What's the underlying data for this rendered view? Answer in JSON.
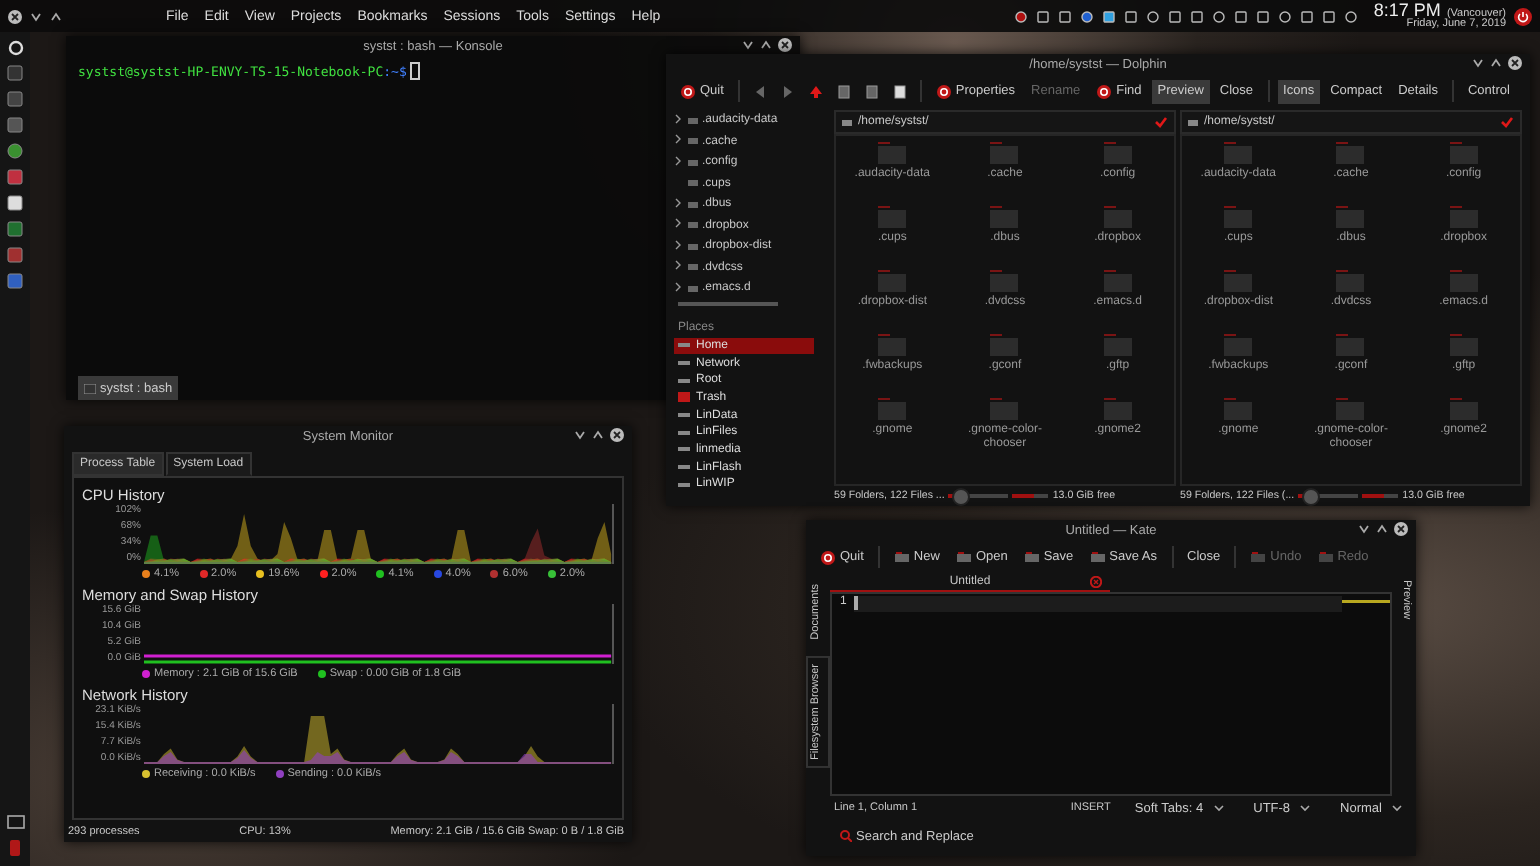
{
  "top_panel": {
    "menu": [
      "File",
      "Edit",
      "View",
      "Projects",
      "Bookmarks",
      "Sessions",
      "Tools",
      "Settings",
      "Help"
    ],
    "clock": {
      "time": "8:17 PM",
      "zone": "(Vancouver)",
      "date": "Friday, June 7, 2019"
    }
  },
  "konsole": {
    "title": "systst : bash — Konsole",
    "prompt": "systst@systst-HP-ENVY-TS-15-Notebook-PC",
    "prompt_suffix": ":~$",
    "tab": "systst : bash"
  },
  "dolphin": {
    "title": "/home/systst — Dolphin",
    "toolbar": [
      {
        "label": "Quit",
        "kind": "icon",
        "selected": false,
        "disabled": false
      },
      {
        "kind": "nav"
      },
      {
        "label": "Properties",
        "kind": "icon",
        "selected": false,
        "disabled": false
      },
      {
        "label": "Rename",
        "kind": "text",
        "selected": false,
        "disabled": true
      },
      {
        "label": "Find",
        "kind": "icon",
        "selected": false,
        "disabled": false
      },
      {
        "label": "Preview",
        "kind": "text",
        "selected": true,
        "disabled": false
      },
      {
        "label": "Close",
        "kind": "text",
        "selected": false,
        "disabled": false
      },
      {
        "label": "Icons",
        "kind": "text",
        "selected": true,
        "disabled": false
      },
      {
        "label": "Compact",
        "kind": "text",
        "selected": false,
        "disabled": false
      },
      {
        "label": "Details",
        "kind": "text",
        "selected": false,
        "disabled": false
      },
      {
        "label": "Control",
        "kind": "text",
        "selected": false,
        "disabled": false
      }
    ],
    "tree": [
      {
        "name": ".audacity-data",
        "expandable": true
      },
      {
        "name": ".cache",
        "expandable": true
      },
      {
        "name": ".config",
        "expandable": true
      },
      {
        "name": ".cups",
        "expandable": false
      },
      {
        "name": ".dbus",
        "expandable": true
      },
      {
        "name": ".dropbox",
        "expandable": true
      },
      {
        "name": ".dropbox-dist",
        "expandable": true
      },
      {
        "name": ".dvdcss",
        "expandable": true
      },
      {
        "name": ".emacs.d",
        "expandable": true
      }
    ],
    "places_heading": "Places",
    "places": [
      {
        "name": "Home",
        "selected": true
      },
      {
        "name": "Network",
        "selected": false
      },
      {
        "name": "Root",
        "selected": false
      },
      {
        "name": "Trash",
        "selected": false
      },
      {
        "name": "LinData",
        "selected": false
      },
      {
        "name": "LinFiles",
        "selected": false
      },
      {
        "name": "linmedia",
        "selected": false
      },
      {
        "name": "LinFlash",
        "selected": false
      },
      {
        "name": "LinWIP",
        "selected": false
      }
    ],
    "panes": [
      {
        "path": "/home/systst/",
        "items": [
          ".audacity-data",
          ".cache",
          ".config",
          ".cups",
          ".dbus",
          ".dropbox",
          ".dropbox-dist",
          ".dvdcss",
          ".emacs.d",
          ".fwbackups",
          ".gconf",
          ".gftp",
          ".gnome",
          ".gnome-color-chooser",
          ".gnome2"
        ],
        "status": "59 Folders, 122 Files ...",
        "zoom": {
          "level": 0.2
        },
        "free": {
          "level": 0.6,
          "text": "13.0 GiB free"
        }
      },
      {
        "path": "/home/systst/",
        "items": [
          ".audacity-data",
          ".cache",
          ".config",
          ".cups",
          ".dbus",
          ".dropbox",
          ".dropbox-dist",
          ".dvdcss",
          ".emacs.d",
          ".fwbackups",
          ".gconf",
          ".gftp",
          ".gnome",
          ".gnome-color-chooser",
          ".gnome2"
        ],
        "status": "59 Folders, 122 Files (...",
        "zoom": {
          "level": 0.2
        },
        "free": {
          "level": 0.6,
          "text": "13.0 GiB free"
        }
      }
    ]
  },
  "system_monitor": {
    "title": "System Monitor",
    "tabs": [
      {
        "label": "Process Table",
        "selected": false
      },
      {
        "label": "System Load",
        "selected": true
      }
    ],
    "sections": [
      {
        "title": "CPU History",
        "kind": "cpu",
        "ticks": [
          "102%",
          "68%",
          "34%",
          "0%"
        ],
        "legend": [
          {
            "text": "4.1%",
            "color": "#e8801c"
          },
          {
            "text": "2.0%",
            "color": "#e02828"
          },
          {
            "text": "19.6%",
            "color": "#e8c020"
          },
          {
            "text": "2.0%",
            "color": "#ff2020"
          },
          {
            "text": "4.1%",
            "color": "#20c020"
          },
          {
            "text": "4.0%",
            "color": "#2848e0"
          },
          {
            "text": "6.0%",
            "color": "#b03030"
          },
          {
            "text": "2.0%",
            "color": "#38c038"
          }
        ]
      },
      {
        "title": "Memory and Swap History",
        "kind": "memory",
        "ticks": [
          "15.6 GiB",
          "10.4 GiB",
          "5.2 GiB",
          "0.0 GiB"
        ],
        "legend": [
          {
            "text": "Memory : 2.1 GiB of 15.6 GiB",
            "color": "#d020d0"
          },
          {
            "text": "Swap : 0.00 GiB of 1.8 GiB",
            "color": "#20c020"
          }
        ]
      },
      {
        "title": "Network History",
        "kind": "network",
        "ticks": [
          "23.1 KiB/s",
          "15.4 KiB/s",
          "7.7 KiB/s",
          "0.0 KiB/s"
        ],
        "legend": [
          {
            "text": "Receiving : 0.0 KiB/s",
            "color": "#d8c030"
          },
          {
            "text": "Sending : 0.0 KiB/s",
            "color": "#9040c0"
          }
        ]
      }
    ],
    "status": [
      "293 processes",
      "CPU: 13%",
      "Memory: 2.1 GiB / 15.6 GiB  Swap: 0 B / 1.8 GiB"
    ]
  },
  "kate": {
    "title": "Untitled — Kate",
    "toolbar": [
      {
        "label": "Quit",
        "disabled": false
      },
      {
        "label": "New",
        "disabled": false
      },
      {
        "label": "Open",
        "disabled": false
      },
      {
        "label": "Save",
        "disabled": false
      },
      {
        "label": "Save As",
        "disabled": false
      },
      {
        "label": "Close",
        "disabled": false
      },
      {
        "label": "Undo",
        "disabled": true
      },
      {
        "label": "Redo",
        "disabled": true
      }
    ],
    "side_tabs": [
      {
        "label": "Documents",
        "selected": false
      },
      {
        "label": "Filesystem Browser",
        "selected": true
      }
    ],
    "doc_tab": "Untitled",
    "line_number": "1",
    "right_tab": "Preview",
    "status": {
      "position": "Line 1, Column 1",
      "mode": "INSERT",
      "tabs": "Soft Tabs: 4",
      "encoding": "UTF-8",
      "input": "Normal"
    },
    "search": "Search and Replace"
  }
}
